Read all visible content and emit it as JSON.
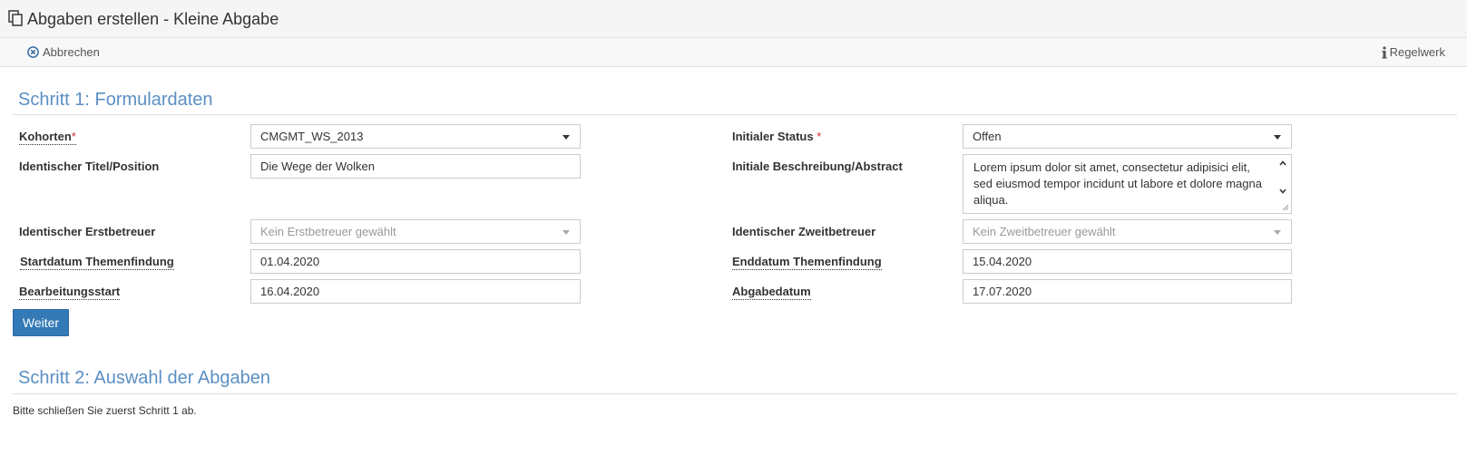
{
  "header": {
    "title": "Abgaben erstellen - Kleine Abgabe",
    "icon": "copy-icon"
  },
  "toolbar": {
    "cancel_label": "Abbrechen",
    "cancel_icon": "times-circle-icon",
    "rules_label": "Regelwerk",
    "rules_icon": "info-icon"
  },
  "step1": {
    "title": "Schritt 1: Formulardaten",
    "fields": {
      "kohorten": {
        "label": "Kohorten",
        "required_mark": "*",
        "value": "CMGMT_WS_2013"
      },
      "initial_status": {
        "label": "Initialer Status",
        "required_mark": "*",
        "value": "Offen"
      },
      "title_position": {
        "label": "Identischer Titel/Position",
        "value": "Die Wege der Wolken"
      },
      "description": {
        "label": "Initiale Beschreibung/Abstract",
        "value": "Lorem ipsum dolor sit amet, consectetur adipisici elit, sed eiusmod tempor incidunt ut labore et dolore magna aliqua."
      },
      "first_supervisor": {
        "label": "Identischer Erstbetreuer",
        "placeholder": "Kein Erstbetreuer gewählt"
      },
      "second_supervisor": {
        "label": "Identischer Zweitbetreuer",
        "placeholder": "Kein Zweitbetreuer gewählt"
      },
      "topic_start": {
        "label": "Startdatum Themenfindung",
        "value": "01.04.2020"
      },
      "topic_end": {
        "label": "Enddatum Themenfindung",
        "value": "15.04.2020"
      },
      "work_start": {
        "label": "Bearbeitungsstart",
        "value": "16.04.2020"
      },
      "due_date": {
        "label": "Abgabedatum",
        "value": "17.07.2020"
      }
    },
    "next_button": "Weiter"
  },
  "step2": {
    "title": "Schritt 2: Auswahl der Abgaben",
    "note": "Bitte schließen Sie zuerst Schritt 1 ab."
  },
  "colors": {
    "accent": "#5b8fc4",
    "primary_button": "#337ab7",
    "required": "#c9302c"
  }
}
